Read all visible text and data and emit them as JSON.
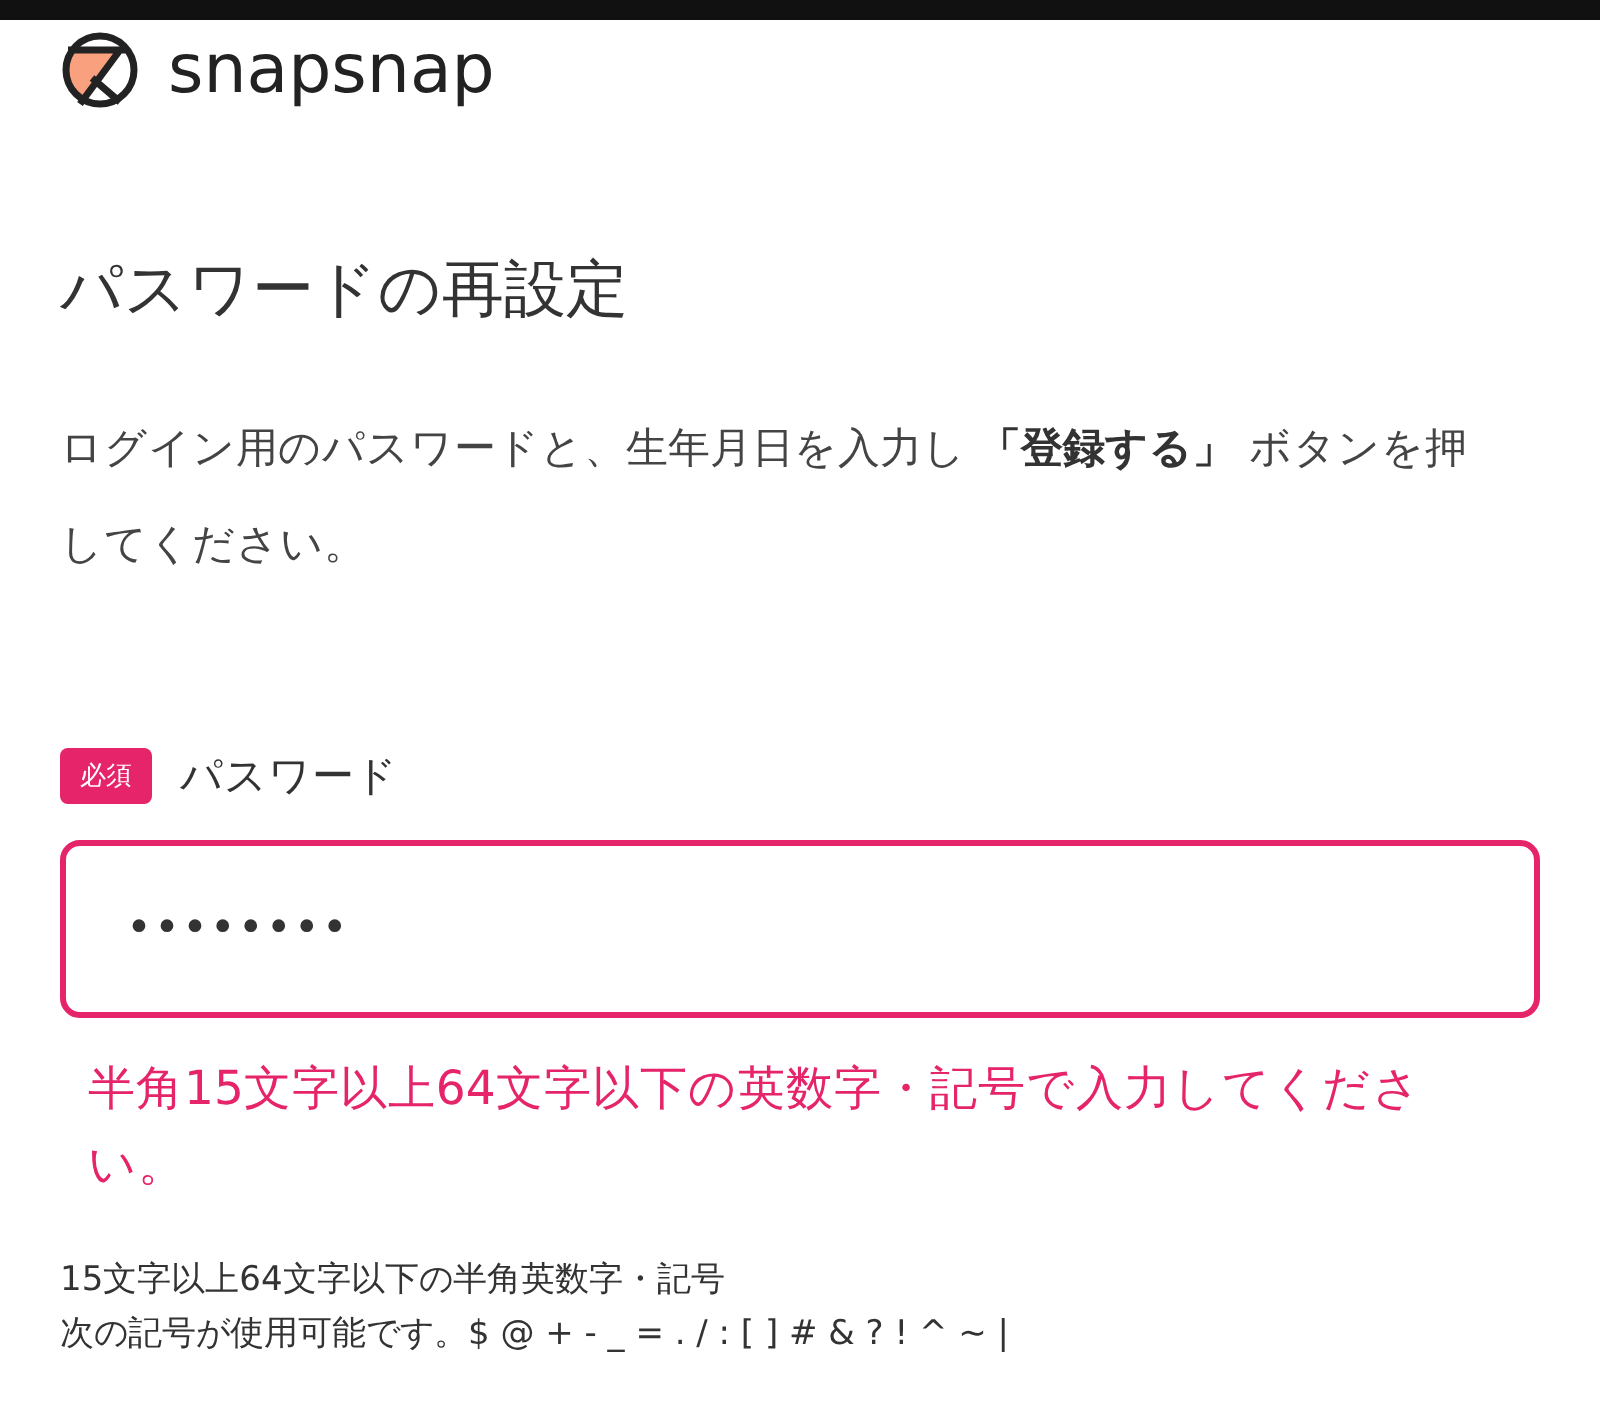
{
  "logo": {
    "text": "snapsnap"
  },
  "title": "パスワードの再設定",
  "description": "ログイン用のパスワードと、生年月日を入力し **「登録する」** ボタンを押してください。",
  "password_field": {
    "required_badge": "必須",
    "label": "パスワード",
    "value": "••••••••",
    "invalid": true,
    "error": "半角15文字以上64文字以下の英数字・記号で入力してください。"
  },
  "hints": [
    "15文字以上64文字以下の半角英数字・記号",
    "次の記号が使用可能です。$ @ + - _ = . / : [ ] # & ? ! ^ ~ |"
  ]
}
